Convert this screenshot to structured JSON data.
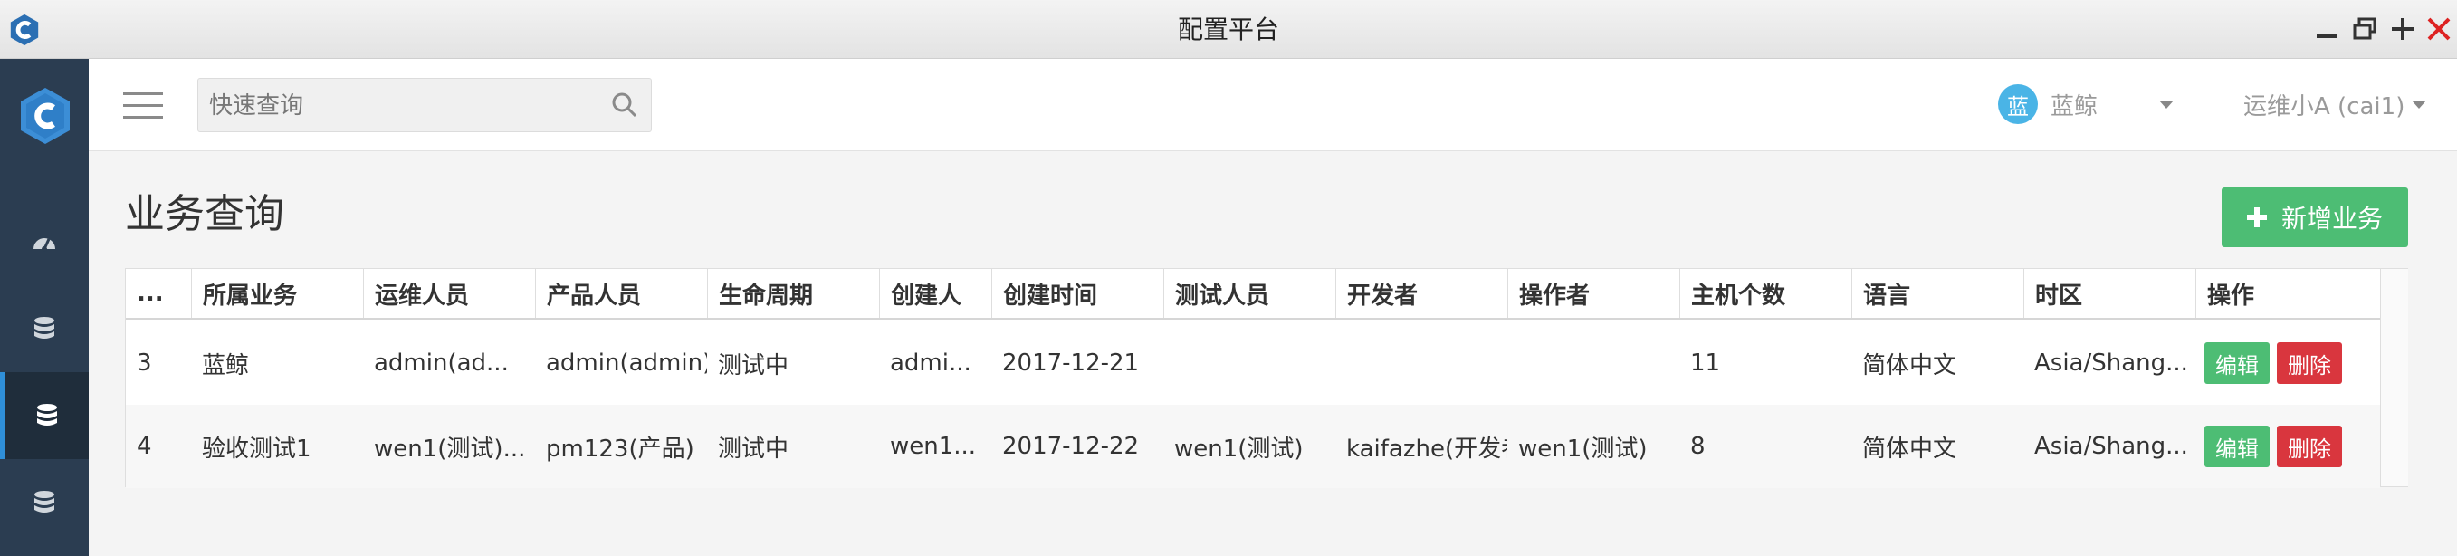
{
  "window": {
    "title": "配置平台",
    "logo_icon": "app-c-logo-icon",
    "controls": [
      "minimize-icon",
      "restore-icon",
      "maximize-icon",
      "close-icon"
    ]
  },
  "sidebar": {
    "logo_icon": "hexagon-c-logo-icon",
    "items": [
      {
        "icon": "dashboard-icon",
        "active": false
      },
      {
        "icon": "database-icon",
        "active": false
      },
      {
        "icon": "database-icon",
        "active": true
      },
      {
        "icon": "database-icon",
        "active": false
      }
    ],
    "colors": {
      "background": "#2b3d51",
      "active_background": "#1f2d3b",
      "active_accent": "#2f8fd8"
    }
  },
  "topbar": {
    "menu_icon": "hamburger-icon",
    "search": {
      "placeholder": "快速查询",
      "value": "",
      "icon": "search-icon"
    },
    "business": {
      "avatar_text": "蓝",
      "label": "蓝鲸",
      "avatar_color": "#4ab4e6"
    },
    "user": {
      "label": "运维小A (cai1)"
    }
  },
  "main": {
    "title": "业务查询",
    "add_button": {
      "label": "新增业务",
      "icon": "plus-icon",
      "color": "#4dbd74"
    },
    "table": {
      "headers": [
        "...",
        "所属业务",
        "运维人员",
        "产品人员",
        "生命周期",
        "创建人",
        "创建时间",
        "测试人员",
        "开发者",
        "操作者",
        "主机个数",
        "语言",
        "时区",
        "操作"
      ],
      "rows": [
        {
          "cells": [
            "3",
            "蓝鲸",
            "admin(ad...",
            "admin(admin)",
            "测试中",
            "admi...",
            "2017-12-21",
            "",
            "",
            "",
            "11",
            "简体中文",
            "Asia/Shang..."
          ],
          "edit": "编辑",
          "delete": "删除"
        },
        {
          "cells": [
            "4",
            "验收测试1",
            "wen1(测试)...",
            "pm123(产品)",
            "测试中",
            "wen1...",
            "2017-12-22",
            "wen1(测试)",
            "kaifazhe(开发者",
            "wen1(测试)",
            "8",
            "简体中文",
            "Asia/Shang..."
          ],
          "edit": "编辑",
          "delete": "删除"
        }
      ],
      "colors": {
        "edit": "#4dbd74",
        "delete": "#d9363e"
      }
    }
  }
}
